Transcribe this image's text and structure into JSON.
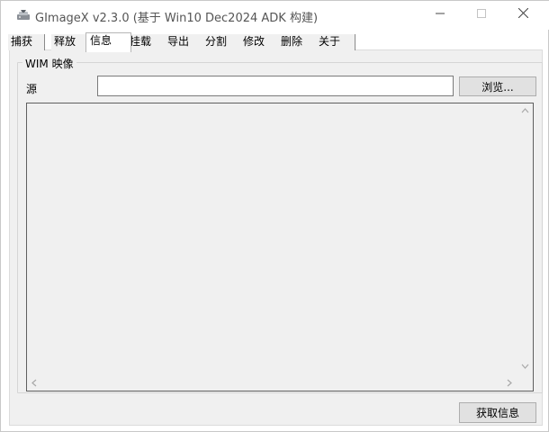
{
  "window": {
    "title": "GImageX v2.3.0 (基于 Win10 Dec2024 ADK 构建)",
    "app_icon": "gimagex-app-icon",
    "controls": {
      "minimize": "—",
      "maximize": "☐",
      "close": "✕"
    }
  },
  "tabs": [
    {
      "label": "捕获",
      "active": false
    },
    {
      "label": "释放",
      "active": false
    },
    {
      "label": "信息",
      "active": true
    },
    {
      "label": "挂载",
      "active": false
    },
    {
      "label": "导出",
      "active": false
    },
    {
      "label": "分割",
      "active": false
    },
    {
      "label": "修改",
      "active": false
    },
    {
      "label": "删除",
      "active": false
    },
    {
      "label": "关于",
      "active": false
    }
  ],
  "info": {
    "group_caption": "WIM 映像",
    "source_label": "源",
    "source_value": "",
    "browse_label": "浏览...",
    "output_text": "",
    "get_info_label": "获取信息"
  }
}
